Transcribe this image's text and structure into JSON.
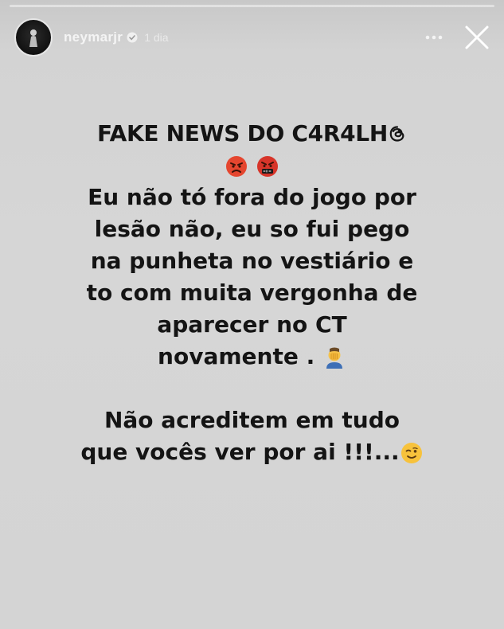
{
  "header": {
    "username": "neymarjr",
    "time": "1 dia",
    "avatar_icon": "avatar-silhouette-icon",
    "verified_icon": "verified-badge-icon",
    "more_icon": "more-dots-icon",
    "close_icon": "close-icon"
  },
  "progress": {
    "fraction": 0.0
  },
  "story": {
    "title_text": "FAKE NEWS DO C4R4LH",
    "title_icon": "threads-icon",
    "emoji_line": [
      "angry-face-icon",
      "face-with-symbols-on-mouth-icon"
    ],
    "lines": [
      "Eu não tó fora do jogo por",
      "lesão não, eu so fui pego",
      "na punheta no vestiário e",
      "to com muita vergonha de",
      "aparecer no CT"
    ],
    "last_line_text": "novamente .",
    "last_line_icon": "facepalm-icon",
    "closing_lines": [
      "Não acreditem em tudo"
    ],
    "closing_last_text": "que vocês ver por ai !!!...",
    "closing_last_icon": "winking-face-icon"
  },
  "colors": {
    "background": "#d4d4d4",
    "text": "#141414",
    "header_text": "#f4f4f4"
  }
}
